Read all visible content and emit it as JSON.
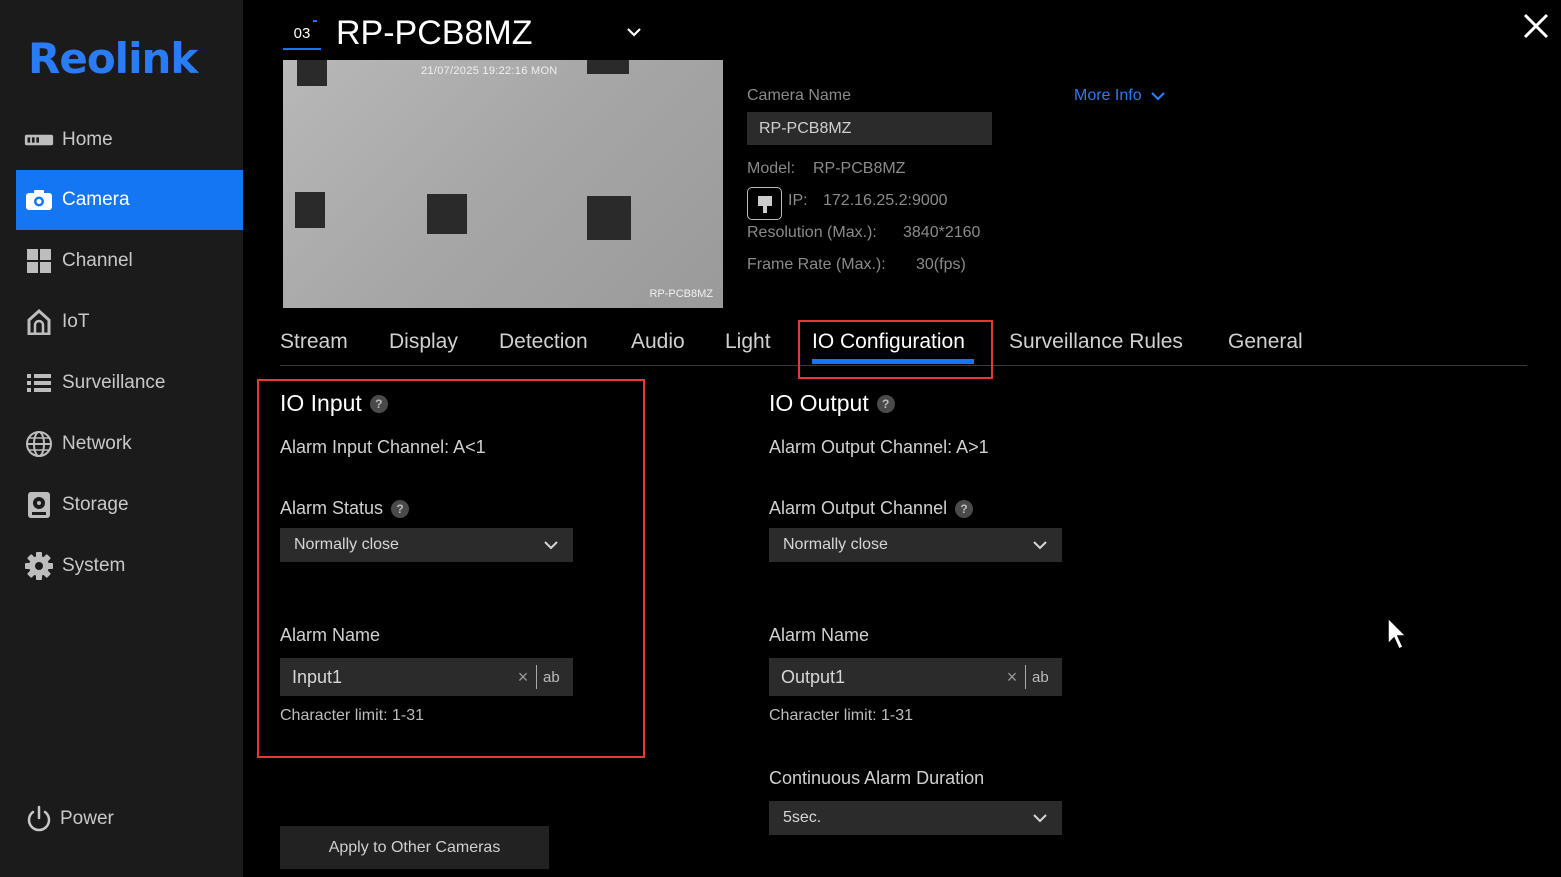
{
  "sidebar": {
    "logo": "Reolink",
    "items": [
      {
        "label": "Home",
        "icon": "home-icon"
      },
      {
        "label": "Camera",
        "icon": "camera-icon"
      },
      {
        "label": "Channel",
        "icon": "channel-icon"
      },
      {
        "label": "IoT",
        "icon": "iot-icon"
      },
      {
        "label": "Surveillance",
        "icon": "surveillance-icon"
      },
      {
        "label": "Network",
        "icon": "network-icon"
      },
      {
        "label": "Storage",
        "icon": "storage-icon"
      },
      {
        "label": "System",
        "icon": "system-icon"
      }
    ],
    "active_index": 1,
    "power_label": "Power"
  },
  "header": {
    "channel_number": "03",
    "camera_title": "RP-PCB8MZ"
  },
  "preview": {
    "timestamp": "21/07/2025 19:22:16 MON",
    "watermark": "RP-PCB8MZ"
  },
  "camera_info": {
    "name_label": "Camera Name",
    "name_value": "RP-PCB8MZ",
    "more_info": "More Info",
    "model_label": "Model:",
    "model_value": "RP-PCB8MZ",
    "ip_label": "IP:",
    "ip_value": "172.16.25.2:9000",
    "resolution_label": "Resolution (Max.):",
    "resolution_value": "3840*2160",
    "framerate_label": "Frame Rate (Max.):",
    "framerate_value": "30(fps)"
  },
  "tabs": [
    "Stream",
    "Display",
    "Detection",
    "Audio",
    "Light",
    "IO Configuration",
    "Surveillance Rules",
    "General"
  ],
  "active_tab": "IO Configuration",
  "io_input": {
    "title": "IO Input",
    "channel_text": "Alarm Input Channel: A<1",
    "status_label": "Alarm Status",
    "status_value": "Normally close",
    "name_label": "Alarm Name",
    "name_value": "Input1",
    "ab": "ab",
    "limit_text": "Character limit: 1-31"
  },
  "io_output": {
    "title": "IO Output",
    "channel_text": "Alarm Output Channel: A>1",
    "channel_label": "Alarm Output Channel",
    "channel_value": "Normally close",
    "name_label": "Alarm Name",
    "name_value": "Output1",
    "ab": "ab",
    "limit_text": "Character limit: 1-31",
    "duration_label": "Continuous Alarm Duration",
    "duration_value": "5sec."
  },
  "apply_button": "Apply to Other Cameras",
  "colors": {
    "accent": "#1476f2",
    "highlight_box": "#e53935",
    "sidebar_bg": "#1b1b1b",
    "field_bg": "#2b2b2b"
  }
}
